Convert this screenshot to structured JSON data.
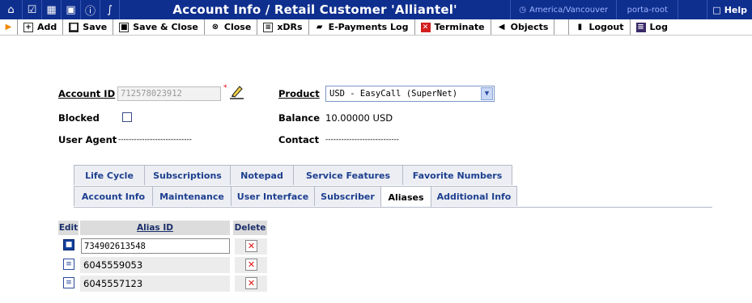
{
  "window": {
    "title": "Account Info / Retail Customer 'Alliantel'",
    "timezone": "America/Vancouver",
    "user": "porta-root",
    "help_label": "Help"
  },
  "topbar_icons": [
    "home-icon",
    "checkbox-icon",
    "layout-icon",
    "dollar-icon",
    "info-icon",
    "chart-icon"
  ],
  "toolbar": {
    "add": "Add",
    "save": "Save",
    "save_close": "Save & Close",
    "close": "Close",
    "xdrs": "xDRs",
    "epayments": "E-Payments Log",
    "terminate": "Terminate",
    "objects": "Objects",
    "logout": "Logout",
    "log": "Log"
  },
  "form": {
    "account_id_label": "Account ID",
    "account_id_value": "712578023912",
    "product_label": "Product",
    "product_value": "USD - EasyCall (SuperNet)",
    "blocked_label": "Blocked",
    "blocked_checked": false,
    "balance_label": "Balance",
    "balance_value": "10.00000 USD",
    "user_agent_label": "User Agent",
    "user_agent_value": "----------------------------",
    "contact_label": "Contact",
    "contact_value": "----------------------------"
  },
  "tabs": {
    "row1": [
      "Life Cycle",
      "Subscriptions",
      "Notepad",
      "Service Features",
      "Favorite Numbers"
    ],
    "row2": [
      "Account Info",
      "Maintenance",
      "User Interface",
      "Subscriber",
      "Aliases",
      "Additional Info"
    ],
    "active": "Aliases"
  },
  "aliases": {
    "headers": {
      "edit": "Edit",
      "alias_id": "Alias ID",
      "delete": "Delete"
    },
    "editing_value": "734902613548",
    "rows": [
      "6045559053",
      "6045557123"
    ]
  }
}
